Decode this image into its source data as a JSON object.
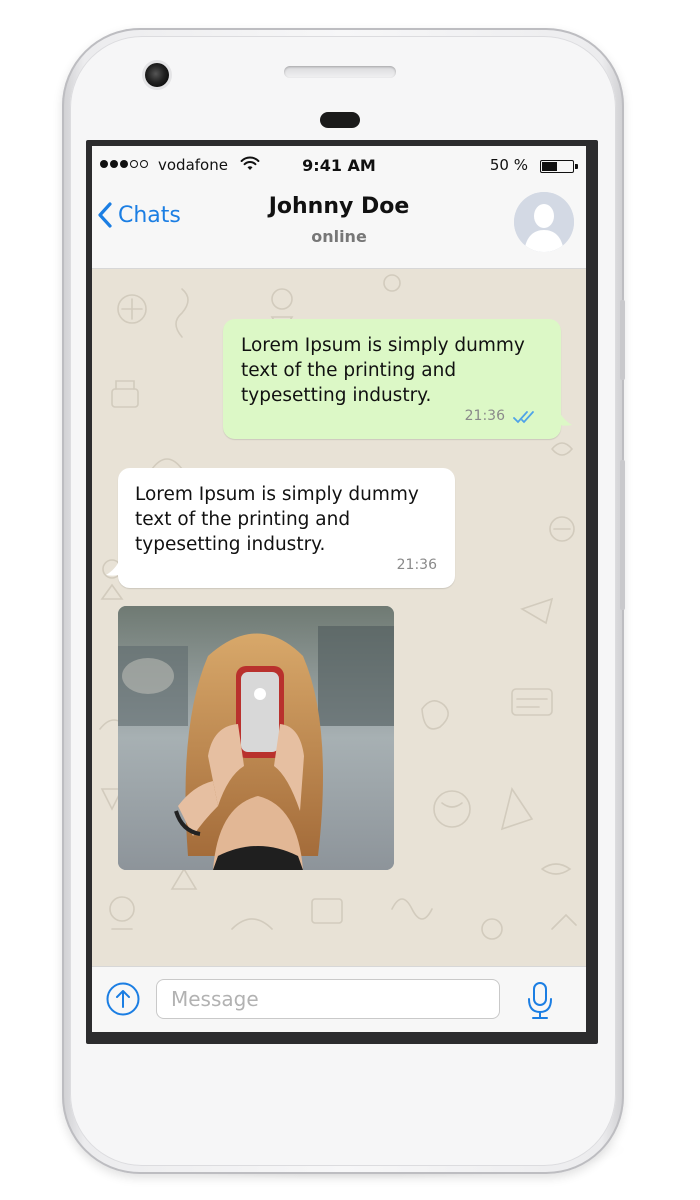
{
  "status_bar": {
    "carrier": "vodafone",
    "signal_bars_filled": 3,
    "signal_bars_total": 5,
    "time": "9:41 AM",
    "battery_text": "50 %",
    "battery_level": 0.5
  },
  "header": {
    "back_label": "Chats",
    "contact_name": "Johnny Doe",
    "contact_status": "online"
  },
  "messages": [
    {
      "direction": "outgoing",
      "text": "Lorem Ipsum is simply dummy text of the printing and typesetting industry.",
      "time": "21:36",
      "read_receipt": "double-check-icon"
    },
    {
      "direction": "incoming",
      "text": "Lorem Ipsum is simply dummy text of the printing and typesetting industry.",
      "time": "21:36"
    },
    {
      "direction": "incoming",
      "type": "photo"
    }
  ],
  "composer": {
    "placeholder": "Message",
    "value": ""
  },
  "colors": {
    "accent": "#1b7ee3",
    "outgoing_bubble": "#dcf8c6",
    "incoming_bubble": "#ffffff",
    "chat_background": "#e8e2d6"
  }
}
